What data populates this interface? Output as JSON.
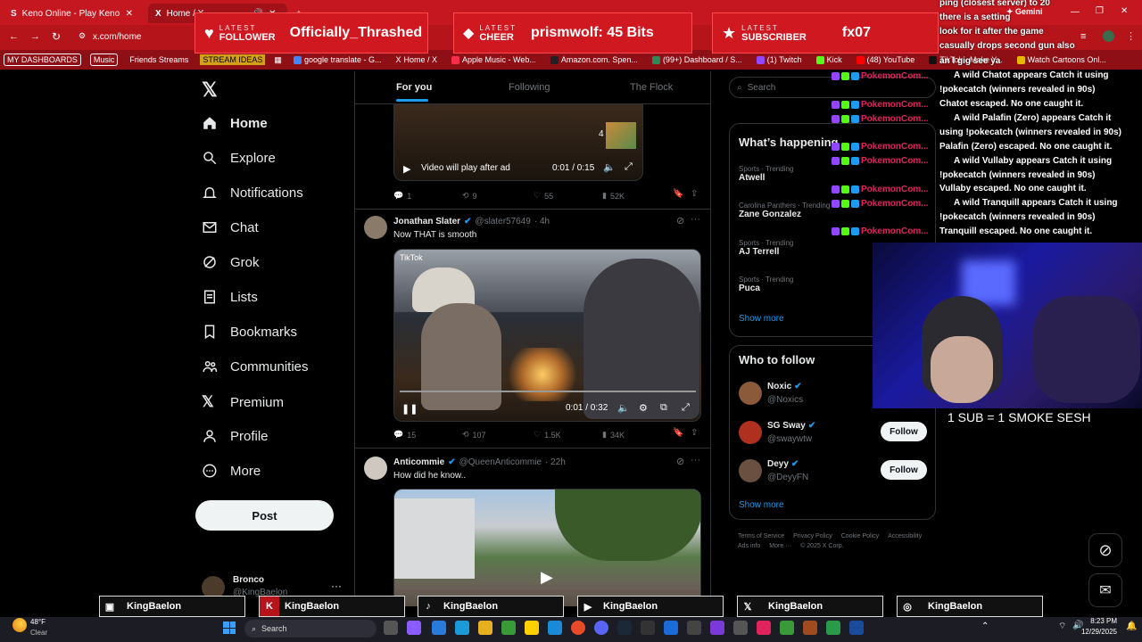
{
  "browser": {
    "tabs": [
      {
        "label": "Keno Online - Play Keno Game"
      },
      {
        "label": "Home / X"
      }
    ],
    "url": "x.com/home",
    "bookmarks": [
      "MY DASHBOARDS",
      "Music",
      "Friends Streams",
      "STREAM IDEAS",
      "google translate - G...",
      "Home / X",
      "Apple Music - Web...",
      "Amazon.com. Spen...",
      "(99+) Dashboard / S...",
      "(1) Twitch",
      "Kick",
      "(48) YouTube",
      "TikTok - Make Y...",
      "Watch Cartoons Onl..."
    ]
  },
  "alerts": {
    "follower": {
      "k1": "LATEST",
      "k2": "FOLLOWER",
      "value": "Officially_Thrashed"
    },
    "cheer": {
      "k1": "LATEST",
      "k2": "CHEER",
      "value": "prismwolf: 45 Bits"
    },
    "subscriber": {
      "k1": "LATEST",
      "k2": "SUBSCRIBER",
      "value": "fx07"
    }
  },
  "nav": {
    "items": [
      "Home",
      "Explore",
      "Notifications",
      "Chat",
      "Grok",
      "Lists",
      "Bookmarks",
      "Communities",
      "Premium",
      "Profile",
      "More"
    ],
    "post_label": "Post",
    "account_name": "Bronco",
    "account_handle": "@KingBaelon"
  },
  "feed": {
    "tabs": [
      "For you",
      "Following",
      "The Flock"
    ],
    "post0": {
      "video_note": "Video will play after ad",
      "time": "0:01 / 0:15",
      "thumb_count": "4",
      "replies": "1",
      "reposts": "9",
      "likes": "55",
      "views": "52K"
    },
    "post1": {
      "author": "Jonathan Slater",
      "handle": "@slater57649",
      "age": "· 4h",
      "text": "Now THAT is smooth",
      "watermark": "TikTok",
      "time": "0:01 / 0:32",
      "replies": "15",
      "reposts": "107",
      "likes": "1.5K",
      "views": "34K"
    },
    "post2": {
      "author": "Anticommie",
      "handle": "@QueenAnticommie",
      "age": "· 22h",
      "text": "How did he know.."
    }
  },
  "right": {
    "search_placeholder": "Search",
    "happening_title": "What’s happening",
    "trends": [
      {
        "meta": "Sports · Trending",
        "name": "Atwell"
      },
      {
        "meta": "Carolina Panthers · Trending",
        "name": "Zane Gonzalez"
      },
      {
        "meta": "Sports · Trending",
        "name": "AJ Terrell"
      },
      {
        "meta": "Sports · Trending",
        "name": "Puca"
      }
    ],
    "show_more": "Show more",
    "wtf_title": "Who to follow",
    "follow": [
      {
        "name": "Noxic",
        "handle": "@Noxics"
      },
      {
        "name": "SG Sway",
        "handle": "@swaywtw"
      },
      {
        "name": "Deyy",
        "handle": "@DeyyFN"
      }
    ],
    "follow_label": "Follow",
    "show_more2": "Show more",
    "footer": [
      "Terms of Service",
      "Privacy Policy",
      "Cookie Policy",
      "Accessibility",
      "Ads info",
      "More ···",
      "© 2025 X Corp."
    ]
  },
  "chat": {
    "lines": [
      "ping (closest server) to 20",
      "there is a setting",
      "look for it after the game",
      "casually drops second gun also",
      "an I gig see ya",
      "A wild Chatot appears  Catch it using",
      "!pokecatch (winners revealed in 90s)",
      "Chatot escaped. No one caught it.",
      "A wild Palafin (Zero) appears  Catch it",
      "using !pokecatch (winners revealed in 90s)",
      "Palafin (Zero) escaped. No one caught it.",
      "A wild Vullaby appears  Catch it using",
      "!pokecatch (winners revealed in 90s)",
      "Vullaby escaped. No one caught it.",
      "A wild Tranquill appears  Catch it using",
      "!pokecatch (winners revealed in 90s)",
      "Tranquill escaped. No one caught it."
    ],
    "bot_name": "PokemonCom...",
    "gemini": "Gemini"
  },
  "webcam_caption": "1 SUB = 1 SMOKE SESH",
  "socials": [
    {
      "platform": "twitch-icon",
      "name": "KingBaelon"
    },
    {
      "platform": "kick-icon",
      "name": "KingBaelon"
    },
    {
      "platform": "tiktok-icon",
      "name": "KingBaelon"
    },
    {
      "platform": "youtube-icon",
      "name": "KingBaelon"
    },
    {
      "platform": "x-icon",
      "name": "KingBaelon"
    },
    {
      "platform": "instagram-icon",
      "name": "KingBaelon"
    }
  ],
  "taskbar": {
    "weather_temp": "48°F",
    "weather_desc": "Clear",
    "search": "Search",
    "time": "8:23 PM",
    "date": "12/29/2025"
  },
  "colors": {
    "accent": "#1d9bf0",
    "brand_red": "#c4171f",
    "bot_red": "#e0245e"
  }
}
